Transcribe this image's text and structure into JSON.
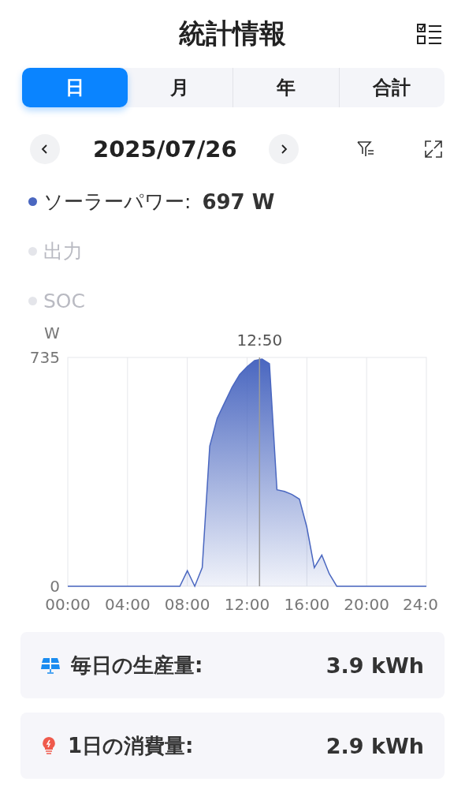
{
  "header": {
    "title": "統計情報"
  },
  "tabs": [
    {
      "label": "日",
      "selected": true
    },
    {
      "label": "月",
      "selected": false
    },
    {
      "label": "年",
      "selected": false
    },
    {
      "label": "合計",
      "selected": false
    }
  ],
  "date": "2025/07/26",
  "legend": [
    {
      "label": "ソーラーパワー:",
      "value": "697 W",
      "on": true,
      "color": "#4a67c0"
    },
    {
      "label": "出力",
      "on": false
    },
    {
      "label": "SOC",
      "on": false
    }
  ],
  "chart": {
    "cursor_time": "12:50",
    "chart_data": {
      "type": "area",
      "ylabel": "W",
      "x": [
        0,
        0.5,
        1,
        1.5,
        2,
        2.5,
        3,
        3.5,
        4,
        4.5,
        5,
        5.5,
        6,
        6.5,
        7,
        7.5,
        8,
        8.5,
        9,
        9.5,
        10,
        10.5,
        11,
        11.5,
        12,
        12.5,
        13,
        13.5,
        14,
        14.5,
        15,
        15.5,
        16,
        16.5,
        17,
        17.5,
        18,
        18.5,
        19,
        19.5,
        20,
        20.5,
        21,
        21.5,
        22,
        22.5,
        23,
        23.5,
        24
      ],
      "series": [
        {
          "color": "#4a67c0",
          "values": [
            0,
            0,
            0,
            0,
            0,
            0,
            0,
            0,
            0,
            0,
            0,
            0,
            0,
            0,
            0,
            0,
            50,
            0,
            60,
            450,
            540,
            590,
            640,
            680,
            705,
            725,
            730,
            715,
            310,
            305,
            295,
            280,
            190,
            60,
            100,
            40,
            0,
            0,
            0,
            0,
            0,
            0,
            0,
            0,
            0,
            0,
            0,
            0,
            0
          ]
        }
      ],
      "xlim": [
        0,
        24
      ],
      "ylim": [
        0,
        735
      ],
      "xticks": [
        {
          "value": 0,
          "label": "00:00"
        },
        {
          "value": 4,
          "label": "04:00"
        },
        {
          "value": 8,
          "label": "08:00"
        },
        {
          "value": 12,
          "label": "12:00"
        },
        {
          "value": 16,
          "label": "16:00"
        },
        {
          "value": 20,
          "label": "20:00"
        },
        {
          "value": 24,
          "label": "24:0"
        }
      ],
      "yticks": [
        0,
        735
      ],
      "grid": true,
      "ref_lines": [
        {
          "axis": "x",
          "value": 12.833
        }
      ]
    }
  },
  "stats": [
    {
      "kind": "solar",
      "label": "毎日の生産量:",
      "value": "3.9 kWh"
    },
    {
      "kind": "bulb",
      "label": "1日の消費量:",
      "value": "2.9 kWh"
    }
  ]
}
